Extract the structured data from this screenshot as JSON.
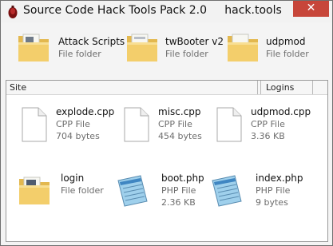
{
  "window": {
    "title": "Source Code Hack Tools Pack 2.0     hack.tools",
    "close_glyph": "✕",
    "accent_close": "#c7463a"
  },
  "top_folders": [
    {
      "name": "Attack Scripts",
      "type": "File folder",
      "icon": "folder-icon"
    },
    {
      "name": "twBooter v2",
      "type": "File folder",
      "icon": "folder-icon"
    },
    {
      "name": "udpmod",
      "type": "File folder",
      "icon": "folder-icon"
    }
  ],
  "columns": {
    "site": "Site",
    "logins": "Logins"
  },
  "files": [
    {
      "name": "explode.cpp",
      "type": "CPP File",
      "size": "704 bytes",
      "icon": "document-icon"
    },
    {
      "name": "misc.cpp",
      "type": "CPP File",
      "size": "454 bytes",
      "icon": "document-icon"
    },
    {
      "name": "udpmod.cpp",
      "type": "CPP File",
      "size": "3.36 KB",
      "icon": "document-icon"
    },
    {
      "name": "login",
      "type": "File folder",
      "size": "",
      "icon": "folder-icon"
    },
    {
      "name": "boot.php",
      "type": "PHP File",
      "size": "2.36 KB",
      "icon": "notepad-icon"
    },
    {
      "name": "index.php",
      "type": "PHP File",
      "size": "9 bytes",
      "icon": "notepad-icon"
    }
  ]
}
